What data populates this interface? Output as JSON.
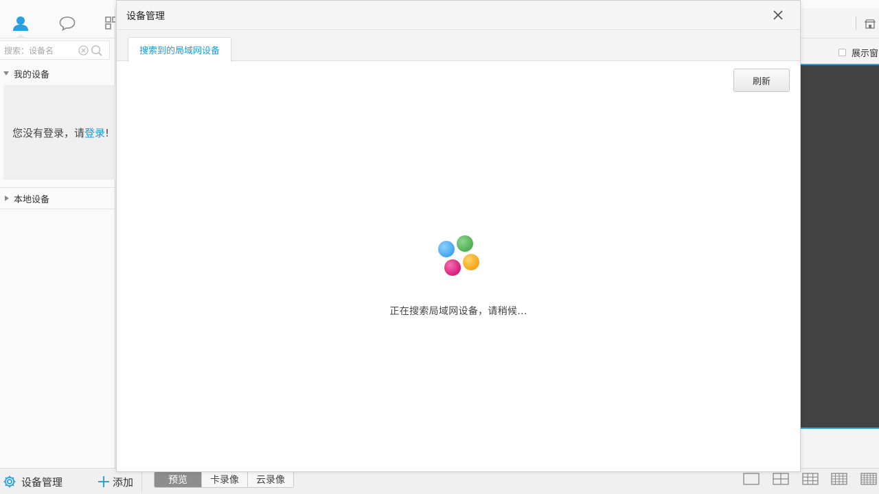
{
  "sidebar": {
    "tabs": [
      {
        "name": "user",
        "icon": "user-icon"
      },
      {
        "name": "messages",
        "icon": "chat-bubble-icon"
      },
      {
        "name": "apps",
        "icon": "grid-icon"
      }
    ],
    "search": {
      "placeholder": "搜索：设备名",
      "value": ""
    },
    "groups": {
      "my_devices": {
        "label": "我的设备",
        "expanded": true
      },
      "local_devices": {
        "label": "本地设备",
        "expanded": false
      }
    },
    "login_prompt": {
      "prefix": "您没有登录，请",
      "link": "登录",
      "suffix": "!"
    }
  },
  "bottom_bar": {
    "device_management": "设备管理",
    "add": "添加",
    "view_tabs": [
      {
        "label": "预览",
        "active": true
      },
      {
        "label": "卡录像",
        "active": false
      },
      {
        "label": "云录像",
        "active": false
      }
    ],
    "layouts": [
      "1x1-layout-icon",
      "2x2-layout-icon",
      "3x3-layout-icon",
      "4x4-layout-icon",
      "5x5-layout-icon"
    ]
  },
  "right_panel": {
    "show_window_label": "展示窗",
    "show_window_checked": false
  },
  "dialog": {
    "title": "设备管理",
    "tab": "搜索到的局域网设备",
    "refresh": "刷新",
    "loading_text": "正在搜索局域网设备，请稍候..."
  },
  "colors": {
    "accent": "#1e9bd7",
    "video_bg": "#424242",
    "spinner": [
      "#4fb1f2",
      "#5cb85c",
      "#e0278a",
      "#f5b21c"
    ]
  }
}
